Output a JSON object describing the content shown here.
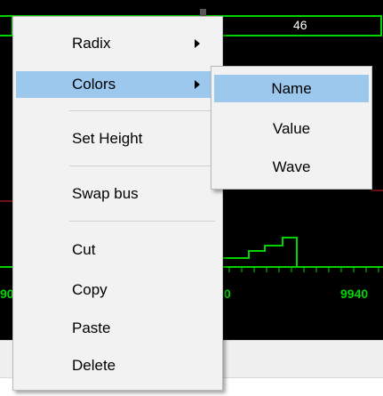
{
  "waveform": {
    "bus_value": "46",
    "timeline_labels": [
      "90",
      "0",
      "9940"
    ]
  },
  "context_menu": {
    "items": [
      {
        "label": "Radix",
        "has_submenu": true
      },
      {
        "label": "Colors",
        "has_submenu": true,
        "highlighted": true
      },
      {
        "label": "Set Height"
      },
      {
        "label": "Swap bus"
      },
      {
        "label": "Cut"
      },
      {
        "label": "Copy"
      },
      {
        "label": "Paste"
      },
      {
        "label": "Delete"
      }
    ]
  },
  "colors_submenu": {
    "items": [
      {
        "label": "Name",
        "highlighted": true
      },
      {
        "label": "Value"
      },
      {
        "label": "Wave"
      }
    ]
  },
  "colors": {
    "wave_green": "#00d400",
    "marker_red": "#e02020",
    "highlight": "#9cc8ee",
    "menu_bg": "#f2f2f2"
  },
  "icons": {
    "submenu_arrow": "chevron-right-icon"
  }
}
